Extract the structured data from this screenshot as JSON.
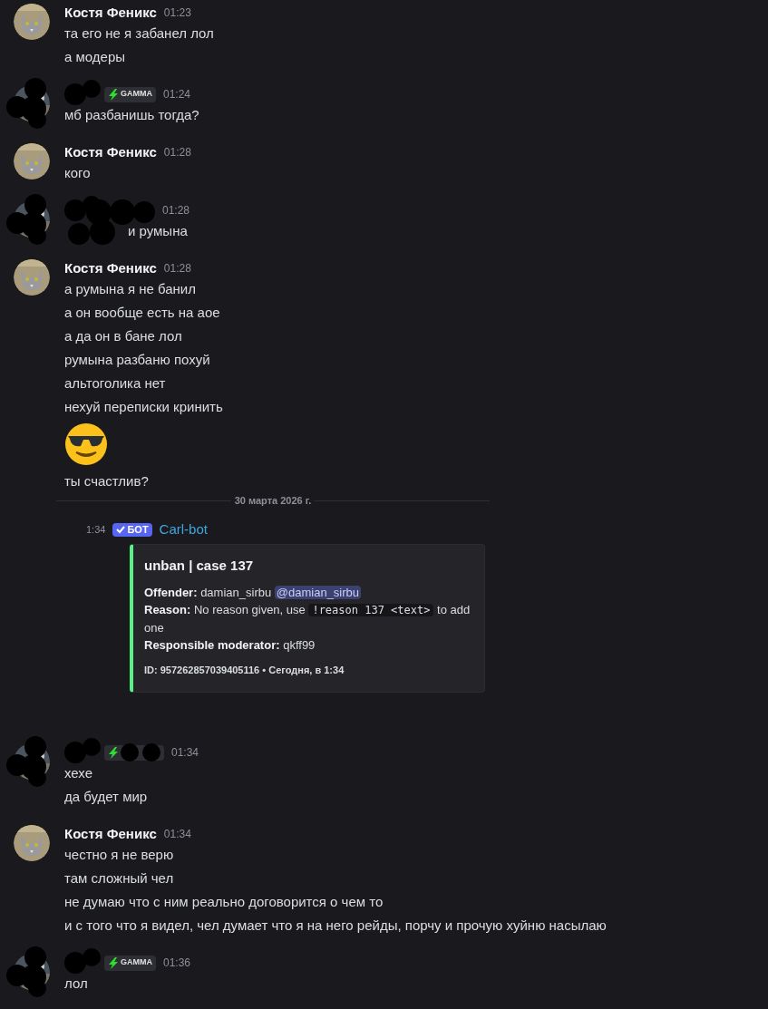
{
  "messages_before": [
    {
      "author": "Костя Феникс",
      "redacted": false,
      "time": "01:23",
      "lines": [
        {
          "kind": "text",
          "text": "та его не я забанел лол"
        },
        {
          "kind": "text",
          "text": "а модеры"
        }
      ]
    },
    {
      "redacted": true,
      "badge": {
        "label": "GAMMA"
      },
      "time": "01:24",
      "lines": [
        {
          "kind": "text",
          "text": "мб разбанишь тогда?"
        }
      ]
    },
    {
      "author": "Костя Феникс",
      "redacted": false,
      "time": "01:28",
      "lines": [
        {
          "kind": "text",
          "text": "кого"
        }
      ]
    },
    {
      "redacted": true,
      "time": "01:28",
      "lines": [
        {
          "kind": "redacted_text",
          "text": "и румына"
        }
      ]
    },
    {
      "author": "Костя Феникс",
      "redacted": false,
      "time": "01:28",
      "lines": [
        {
          "kind": "text",
          "text": "а румына я не банил"
        },
        {
          "kind": "text",
          "text": "а он вообще есть на аое"
        },
        {
          "kind": "text",
          "text": "а да он в бане лол"
        },
        {
          "kind": "text",
          "text": "румына разбаню похуй"
        },
        {
          "kind": "text",
          "text": "альтоголика нет"
        },
        {
          "kind": "text",
          "text": "нехуй переписки кринить"
        },
        {
          "kind": "emoji"
        },
        {
          "kind": "text",
          "text": "ты счастлив?"
        }
      ]
    }
  ],
  "date_divider": "30 марта 2026 г.",
  "bot_message": {
    "time": "1:34",
    "badge": "БОТ",
    "author": "Carl-bot",
    "embed": {
      "color": "#57f287",
      "title": "unban | case 137",
      "fields": [
        {
          "label": "Offender:",
          "parts": [
            {
              "kind": "text",
              "text": "damian_sirbu"
            },
            {
              "kind": "mention",
              "text": "@damian_sirbu"
            }
          ]
        },
        {
          "label": "Reason:",
          "parts": [
            {
              "kind": "text",
              "text": "No reason given, use"
            },
            {
              "kind": "code",
              "text": "!reason 137 <text>"
            },
            {
              "kind": "text",
              "text": "to add one"
            }
          ]
        },
        {
          "label": "Responsible moderator:",
          "parts": [
            {
              "kind": "text",
              "text": "qkff99"
            }
          ]
        }
      ],
      "footer": "ID: 957262857039405116 • Сегодня, в 1:34"
    }
  },
  "messages_after": [
    {
      "redacted": true,
      "badge": {
        "kind": "covered"
      },
      "time": "01:34",
      "lines": [
        {
          "kind": "text",
          "text": "хехе"
        },
        {
          "kind": "text",
          "text": "да будет мир"
        }
      ]
    },
    {
      "author": "Костя Феникс",
      "redacted": false,
      "time": "01:34",
      "lines": [
        {
          "kind": "text",
          "text": "честно я не верю"
        },
        {
          "kind": "text",
          "text": "там сложный чел"
        },
        {
          "kind": "text",
          "text": "не думаю что с ним реально договорится о чем то"
        },
        {
          "kind": "text",
          "text": "и с того что я видел, чел думает что я на него рейды, порчу и прочую хуйню насылаю"
        }
      ]
    },
    {
      "redacted": true,
      "badge": {
        "label": "GAMMA"
      },
      "time": "01:36",
      "lines": [
        {
          "kind": "text",
          "text": "лол"
        }
      ]
    }
  ]
}
